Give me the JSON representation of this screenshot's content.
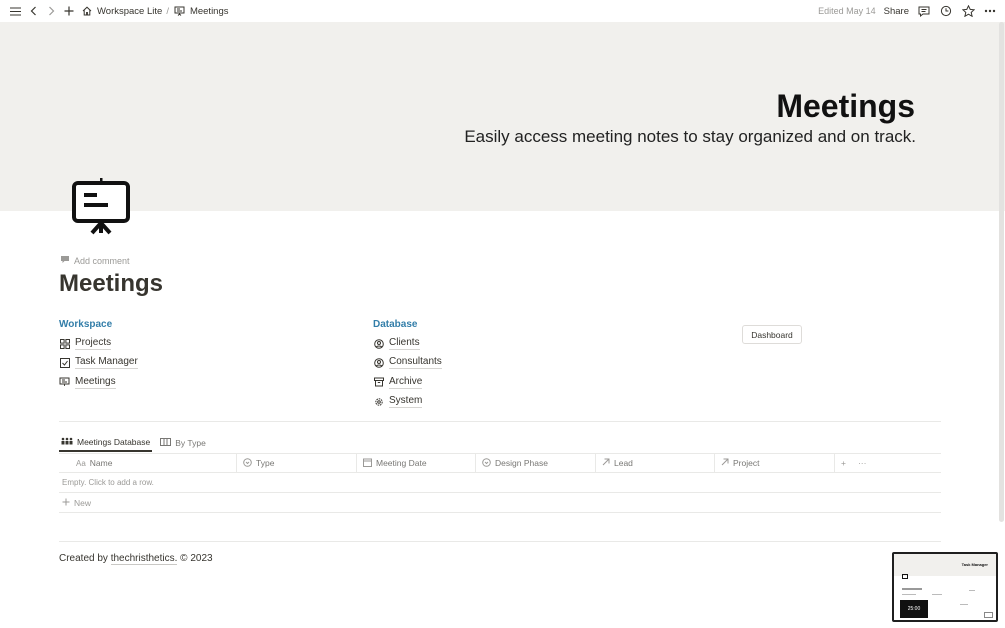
{
  "topbar": {
    "breadcrumb_workspace": "Workspace Lite",
    "breadcrumb_sep": "/",
    "breadcrumb_page": "Meetings",
    "edited": "Edited May 14",
    "share": "Share"
  },
  "cover": {
    "title": "Meetings",
    "subtitle": "Easily access meeting notes to stay organized and on track."
  },
  "page": {
    "add_comment": "Add comment",
    "title": "Meetings"
  },
  "workspace": {
    "heading": "Workspace",
    "items": [
      {
        "label": "Projects",
        "icon": "grid-icon"
      },
      {
        "label": "Task Manager",
        "icon": "checkbox-icon"
      },
      {
        "label": "Meetings",
        "icon": "presentation-icon"
      }
    ]
  },
  "database": {
    "heading": "Database",
    "items": [
      {
        "label": "Clients",
        "icon": "user-circle-icon"
      },
      {
        "label": "Consultants",
        "icon": "user-circle-icon"
      },
      {
        "label": "Archive",
        "icon": "archive-icon"
      },
      {
        "label": "System",
        "icon": "gear-icon"
      }
    ]
  },
  "dashboard_button": "Dashboard",
  "views": {
    "tabs": [
      {
        "label": "Meetings Database",
        "icon": "people-icon",
        "active": true
      },
      {
        "label": "By Type",
        "icon": "board-icon",
        "active": false
      }
    ]
  },
  "table": {
    "columns": [
      {
        "label": "Name",
        "icon": "Aa"
      },
      {
        "label": "Type",
        "icon": "select-icon"
      },
      {
        "label": "Meeting Date",
        "icon": "calendar-icon"
      },
      {
        "label": "Design Phase",
        "icon": "select-icon"
      },
      {
        "label": "Lead",
        "icon": "relation-arrow-icon"
      },
      {
        "label": "Project",
        "icon": "relation-arrow-icon"
      }
    ],
    "add_column": "+",
    "more": "···",
    "empty_text": "Empty. Click to add a row.",
    "new_label": "New"
  },
  "footer": {
    "prefix": "Created by ",
    "author": "thechristhetics.",
    "suffix": " © 2023"
  },
  "thumbnail": {
    "title": "Task Manager",
    "timer": "25:00"
  },
  "colors": {
    "cover_bg": "#f1f0ed",
    "heading_blue": "#337ea9",
    "text": "#37352f",
    "muted": "#9b9a97"
  }
}
